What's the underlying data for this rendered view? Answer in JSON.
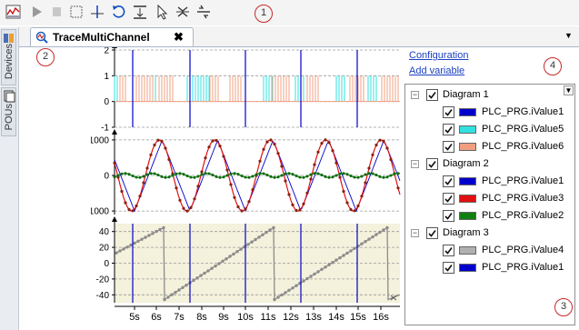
{
  "toolbar": {
    "buttons": [
      {
        "icon": "trace-config-icon"
      },
      {
        "icon": "play-icon"
      },
      {
        "icon": "stop-icon"
      },
      {
        "icon": "marquee-select-icon"
      },
      {
        "icon": "crosshair-cursor-icon"
      },
      {
        "icon": "reset-view-icon"
      },
      {
        "icon": "compress-icon"
      },
      {
        "icon": "pointer-icon"
      },
      {
        "icon": "zoom-y-icon"
      },
      {
        "icon": "zoom-x-icon"
      }
    ]
  },
  "callouts": {
    "c1": "1",
    "c2": "2",
    "c3": "3",
    "c4": "4"
  },
  "left_tabs": {
    "devices": "Devices",
    "pous": "POUs"
  },
  "editor": {
    "tab_title": "TraceMultiChannel",
    "close": "✖"
  },
  "panel": {
    "configuration": "Configuration",
    "add_variable": "Add variable"
  },
  "tree": [
    {
      "label": "Diagram 1",
      "children": [
        {
          "label": "PLC_PRG.iValue1",
          "color": "#0000cc"
        },
        {
          "label": "PLC_PRG.iValue5",
          "color": "#33e0e0"
        },
        {
          "label": "PLC_PRG.iValue6",
          "color": "#f0a080"
        }
      ]
    },
    {
      "label": "Diagram 2",
      "children": [
        {
          "label": "PLC_PRG.iValue1",
          "color": "#0000cc"
        },
        {
          "label": "PLC_PRG.iValue3",
          "color": "#e01010"
        },
        {
          "label": "PLC_PRG.iValue2",
          "color": "#108010"
        }
      ]
    },
    {
      "label": "Diagram 3",
      "children": [
        {
          "label": "PLC_PRG.iValue4",
          "color": "#b0b0b0"
        },
        {
          "label": "PLC_PRG.iValue1",
          "color": "#0000cc"
        }
      ]
    }
  ],
  "chart_data": [
    {
      "type": "line",
      "y_ticks": [
        "2",
        "1",
        "0",
        "-1"
      ],
      "ylim": [
        -1,
        2
      ],
      "series": [
        {
          "name": "PLC_PRG.iValue1",
          "color": "#0000cc"
        },
        {
          "name": "PLC_PRG.iValue5",
          "color": "#33e0e0"
        },
        {
          "name": "PLC_PRG.iValue6",
          "color": "#f0a080"
        }
      ]
    },
    {
      "type": "line",
      "y_ticks": [
        "1000",
        "0",
        "-1000"
      ],
      "ylim": [
        -1100,
        1100
      ],
      "series": [
        {
          "name": "PLC_PRG.iValue1",
          "color": "#0000cc"
        },
        {
          "name": "PLC_PRG.iValue3",
          "color": "#e01010"
        },
        {
          "name": "PLC_PRG.iValue2",
          "color": "#108010"
        }
      ]
    },
    {
      "type": "line",
      "y_ticks": [
        "40",
        "20",
        "0",
        "-20",
        "-40"
      ],
      "ylim": [
        -50,
        50
      ],
      "series": [
        {
          "name": "PLC_PRG.iValue4",
          "color": "#b0b0b0"
        },
        {
          "name": "PLC_PRG.iValue1",
          "color": "#0000cc"
        }
      ]
    }
  ],
  "x_axis": {
    "ticks": [
      "5s",
      "6s",
      "7s",
      "8s",
      "9s",
      "10s",
      "11s",
      "12s",
      "13s",
      "14s",
      "15s",
      "16s"
    ]
  }
}
